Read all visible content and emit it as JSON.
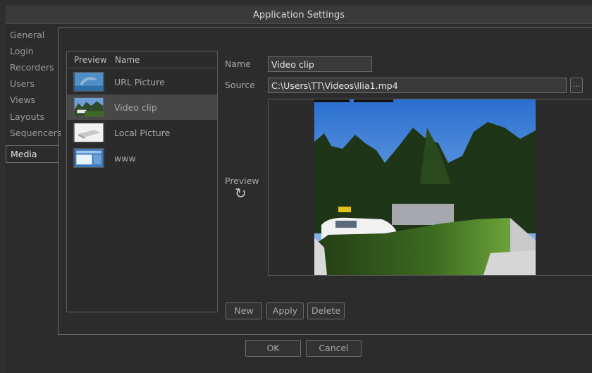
{
  "window": {
    "title": "Application Settings"
  },
  "nav": {
    "items": [
      {
        "label": "General",
        "active": false
      },
      {
        "label": "Login",
        "active": false
      },
      {
        "label": "Recorders",
        "active": false
      },
      {
        "label": "Users",
        "active": false
      },
      {
        "label": "Views",
        "active": false
      },
      {
        "label": "Layouts",
        "active": false
      },
      {
        "label": "Sequencers",
        "active": false
      },
      {
        "label": "Media",
        "active": true
      }
    ]
  },
  "media_list": {
    "columns": [
      "Preview",
      "Name"
    ],
    "items": [
      {
        "name": "URL Picture",
        "thumb": "dolphin"
      },
      {
        "name": "Video clip",
        "thumb": "street",
        "selected": true
      },
      {
        "name": "Local Picture",
        "thumb": "device"
      },
      {
        "name": "www",
        "thumb": "webpage"
      }
    ]
  },
  "form": {
    "name_label": "Name",
    "name_value": "Video clip",
    "source_label": "Source",
    "source_value": "C:\\Users\\TT\\Videos\\Ilia1.mp4",
    "browse_label": "...",
    "preview_label": "Preview",
    "refresh_icon": "↻"
  },
  "actions": {
    "new": "New",
    "apply": "Apply",
    "delete": "Delete"
  },
  "dialog": {
    "ok": "OK",
    "cancel": "Cancel"
  }
}
